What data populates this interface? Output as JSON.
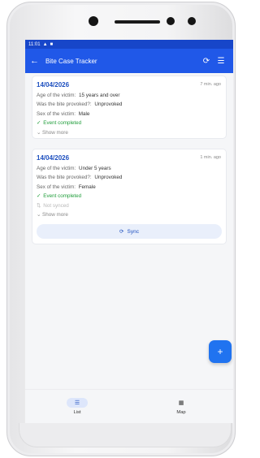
{
  "statusbar": {
    "time": "11:01",
    "icons": [
      "warning-icon",
      "sim-icon"
    ]
  },
  "appbar": {
    "title": "Bite Case Tracker",
    "back_icon": "arrow-left-icon",
    "sync_icon": "sync-icon",
    "filter_icon": "filter-icon"
  },
  "records": [
    {
      "date": "14/04/2026",
      "time_ago": "7 min. ago",
      "fields": [
        {
          "label": "Age of the victim:",
          "value": "15 years and over"
        },
        {
          "label": "Was the bite provoked?:",
          "value": "Unprovoked"
        },
        {
          "label": "Sex of the victim:",
          "value": "Male"
        }
      ],
      "status": "Event completed",
      "show_more": "Show more"
    },
    {
      "date": "14/04/2026",
      "time_ago": "1 min. ago",
      "fields": [
        {
          "label": "Age of the victim:",
          "value": "Under 5 years"
        },
        {
          "label": "Was the bite provoked?:",
          "value": "Unprovoked"
        },
        {
          "label": "Sex of the victim:",
          "value": "Female"
        }
      ],
      "status": "Event completed",
      "sync_status": "Not synced",
      "show_more": "Show more",
      "sync_label": "Sync"
    }
  ],
  "fab": {
    "label": "+"
  },
  "bottom_nav": [
    {
      "label": "List",
      "icon": "list-icon",
      "active": true
    },
    {
      "label": "Map",
      "icon": "map-icon",
      "active": false
    }
  ],
  "colors": {
    "primary": "#2058e8",
    "statusbar": "#1746c9",
    "accent": "#1d4fbf",
    "success": "#1f9d3a",
    "fab": "#2073f0"
  }
}
